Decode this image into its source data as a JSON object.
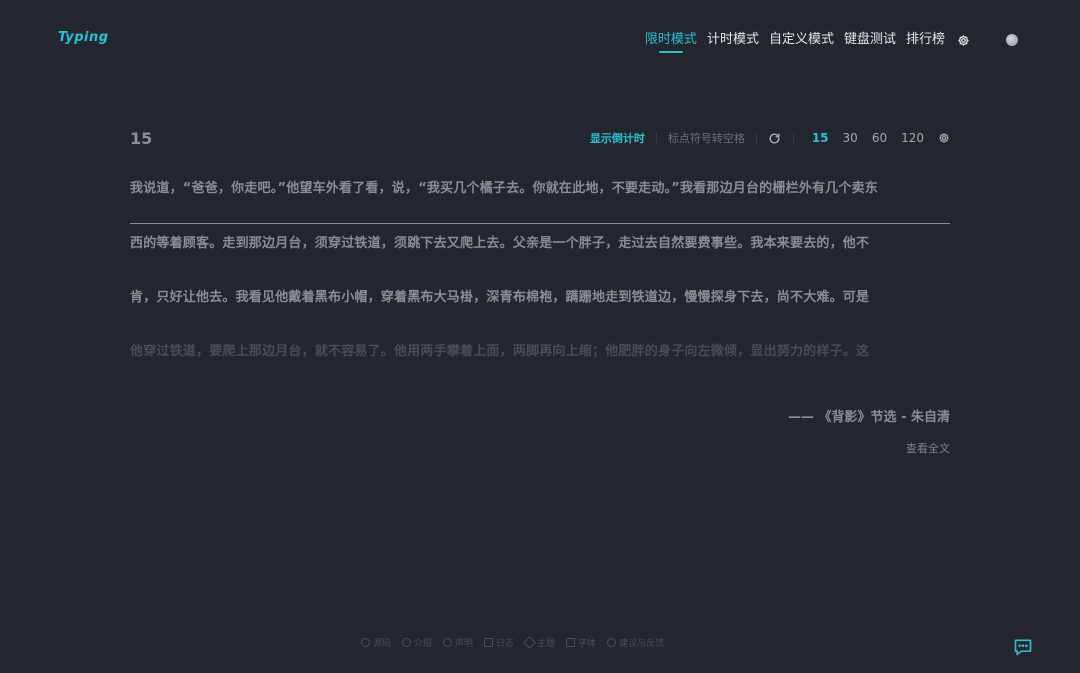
{
  "app": {
    "logo": "Typing"
  },
  "nav": {
    "items": [
      {
        "label": "限时模式",
        "active": true
      },
      {
        "label": "计时模式",
        "active": false
      },
      {
        "label": "自定义模式",
        "active": false
      },
      {
        "label": "键盘测试",
        "active": false
      },
      {
        "label": "排行榜",
        "active": false
      }
    ],
    "settings_icon": "gear-icon",
    "avatar_icon": "avatar"
  },
  "toolbar": {
    "counter": "15",
    "countdown_label": "显示倒计时",
    "punct_label": "标点符号转空格",
    "refresh_icon": "refresh-icon",
    "durations": [
      "15",
      "30",
      "60",
      "120"
    ],
    "selected_duration": "15",
    "settings_icon": "gear-icon"
  },
  "passage": {
    "lines": [
      "我说道，“爸爸，你走吧。”他望车外看了看，说，“我买几个橘子去。你就在此地，不要走动。”我看那边月台的栅栏外有几个卖东",
      "西的等着顾客。走到那边月台，须穿过铁道，须跳下去又爬上去。父亲是一个胖子，走过去自然要费事些。我本来要去的，他不",
      "肯，只好让他去。我看见他戴着黑布小帽，穿着黑布大马褂，深青布棉袍，蹒跚地走到铁道边，慢慢探身下去，尚不大难。可是",
      "他穿过铁道，要爬上那边月台，就不容易了。他用两手攀着上面，两脚再向上缩；他肥胖的身子向左微倾，显出努力的样子。这"
    ],
    "source": "—— 《背影》节选 - 朱自清",
    "read_full": "查看全文"
  },
  "footer": {
    "items": [
      {
        "label": "源码",
        "icon": "github-icon"
      },
      {
        "label": "介绍",
        "icon": "info-icon"
      },
      {
        "label": "声明",
        "icon": "shield-icon"
      },
      {
        "label": "日志",
        "icon": "log-icon"
      },
      {
        "label": "主题",
        "icon": "palette-icon"
      },
      {
        "label": "字体",
        "icon": "font-icon"
      },
      {
        "label": "建议与反馈",
        "icon": "feedback-icon"
      }
    ]
  },
  "colors": {
    "background": "#23262f",
    "accent": "#2ac0d0",
    "text": "#8b8d93"
  }
}
